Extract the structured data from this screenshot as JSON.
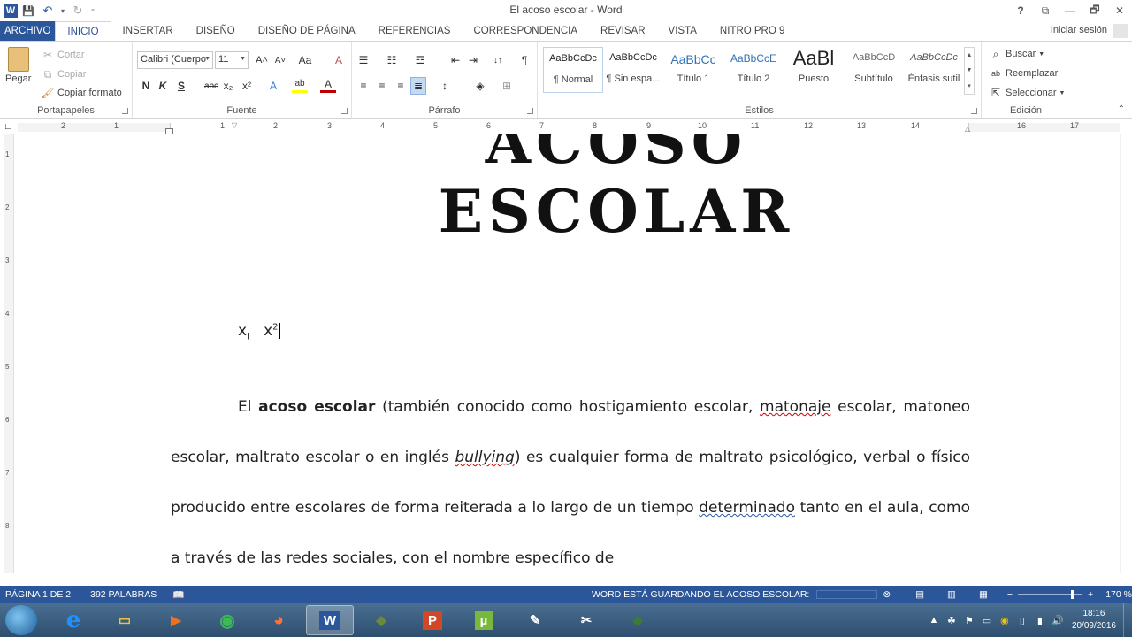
{
  "window": {
    "title": "El acoso escolar - Word"
  },
  "titlebar": {
    "help": "?",
    "ribbon_display": "⧉",
    "minimize": "—",
    "restore": "🗗",
    "close": "✕"
  },
  "qat": {
    "word": "W",
    "save": "💾",
    "undo": "↶",
    "dropdown": "▾",
    "redo": "↻",
    "customize": "⁼"
  },
  "tabs": [
    {
      "label": "ARCHIVO"
    },
    {
      "label": "INICIO"
    },
    {
      "label": "INSERTAR"
    },
    {
      "label": "DISEÑO"
    },
    {
      "label": "DISEÑO DE PÁGINA"
    },
    {
      "label": "REFERENCIAS"
    },
    {
      "label": "CORRESPONDENCIA"
    },
    {
      "label": "REVISAR"
    },
    {
      "label": "VISTA"
    },
    {
      "label": "NITRO PRO 9"
    }
  ],
  "signin": "Iniciar sesión",
  "clipboard": {
    "paste": "Pegar",
    "cut": "Cortar",
    "copy": "Copiar",
    "format_painter": "Copiar formato",
    "label": "Portapapeles"
  },
  "font": {
    "name": "Calibri (Cuerpo",
    "size": "11",
    "grow": "A˄",
    "shrink": "A˅",
    "case": "Aa",
    "clear": "A",
    "bold": "N",
    "italic": "K",
    "underline": "S",
    "strike": "abc",
    "subscript": "x₂",
    "superscript": "x²",
    "effects": "A",
    "highlight": "ab",
    "color": "A",
    "label": "Fuente",
    "accent_color": "#c00000",
    "highlight_color": "#ffff00"
  },
  "paragraph": {
    "label": "Párrafo",
    "bullets": "☰",
    "numbering": "☷",
    "multilevel": "☲",
    "decrease_indent": "⇤",
    "increase_indent": "⇥",
    "sort": "↓↑",
    "pilcrow": "¶",
    "align_left": "≡",
    "center": "≡",
    "align_right": "≡",
    "justify": "≣",
    "spacing": "↕",
    "shading": "◈",
    "borders": "⊞"
  },
  "styles": {
    "label": "Estilos",
    "items": [
      {
        "preview": "AaBbCcDc",
        "name": "¶ Normal"
      },
      {
        "preview": "AaBbCcDc",
        "name": "¶ Sin espa..."
      },
      {
        "preview": "AaBbCc",
        "name": "Título 1"
      },
      {
        "preview": "AaBbCcE",
        "name": "Título 2"
      },
      {
        "preview": "AaBl",
        "name": "Puesto"
      },
      {
        "preview": "AaBbCcD",
        "name": "Subtítulo"
      },
      {
        "preview": "AaBbCcDc",
        "name": "Énfasis sutil"
      }
    ]
  },
  "editing": {
    "label": "Edición",
    "find": "Buscar",
    "replace": "Reemplazar",
    "select": "Seleccionar"
  },
  "ruler": {
    "numbers": [
      "2",
      "1",
      "1",
      "2",
      "3",
      "4",
      "5",
      "6",
      "7",
      "8",
      "9",
      "10",
      "11",
      "12",
      "13",
      "14",
      "16",
      "17"
    ],
    "vertical": [
      "1",
      "2",
      "3",
      "4",
      "5",
      "6",
      "7",
      "8"
    ]
  },
  "document": {
    "heading": "ACOSO ESCOLAR",
    "formula_base1": "x",
    "formula_sub": "i",
    "formula_base2": "x",
    "formula_sup": "2",
    "para_el": "El",
    "para_bold": "acoso escolar",
    "para_t1": "(también conocido como hostigamiento escolar,",
    "para_matonaje": "matonaje",
    "para_t2": "escolar, matoneo escolar, maltrato escolar o en inglés",
    "para_bullying": "bullying",
    "para_t3": ") es cualquier forma de maltrato psicológico, verbal o físico producido entre escolares de forma reiterada a lo largo de un tiempo",
    "para_determinado": "determinado",
    "para_t4": "tanto en el aula, como a través de las redes sociales, con el nombre específico de"
  },
  "status": {
    "page": "PÁGINA 1 DE 2",
    "words": "392 PALABRAS",
    "saving": "WORD ESTÁ GUARDANDO EL ACOSO ESCOLAR:",
    "zoom": "170 %",
    "zoom_value": 170,
    "accent": "#2b579a"
  },
  "taskbar": {
    "time": "18:16",
    "date": "20/09/2016",
    "apps": [
      {
        "icon": "ie-icon",
        "glyph": "e",
        "color": "#1e90ff"
      },
      {
        "icon": "folder-icon",
        "glyph": "▭",
        "color": "#f0c040"
      },
      {
        "icon": "media-player-icon",
        "glyph": "▶",
        "color": "#f07020"
      },
      {
        "icon": "chrome-icon",
        "glyph": "◉",
        "color": "#3cba54"
      },
      {
        "icon": "firefox-icon",
        "glyph": "◕",
        "color": "#ff7139"
      },
      {
        "icon": "word-icon",
        "glyph": "W",
        "color": "#ffffff"
      },
      {
        "icon": "app-green-icon",
        "glyph": "◆",
        "color": "#6a8a3a"
      },
      {
        "icon": "powerpoint-icon",
        "glyph": "P",
        "color": "#ffffff"
      },
      {
        "icon": "utorrent-icon",
        "glyph": "µ",
        "color": "#ffffff"
      },
      {
        "icon": "paint-icon",
        "glyph": "✎",
        "color": "#ffffff"
      },
      {
        "icon": "snipping-icon",
        "glyph": "✂",
        "color": "#ffffff"
      },
      {
        "icon": "app-cube-icon",
        "glyph": "◆",
        "color": "#3a7a3a"
      }
    ]
  }
}
